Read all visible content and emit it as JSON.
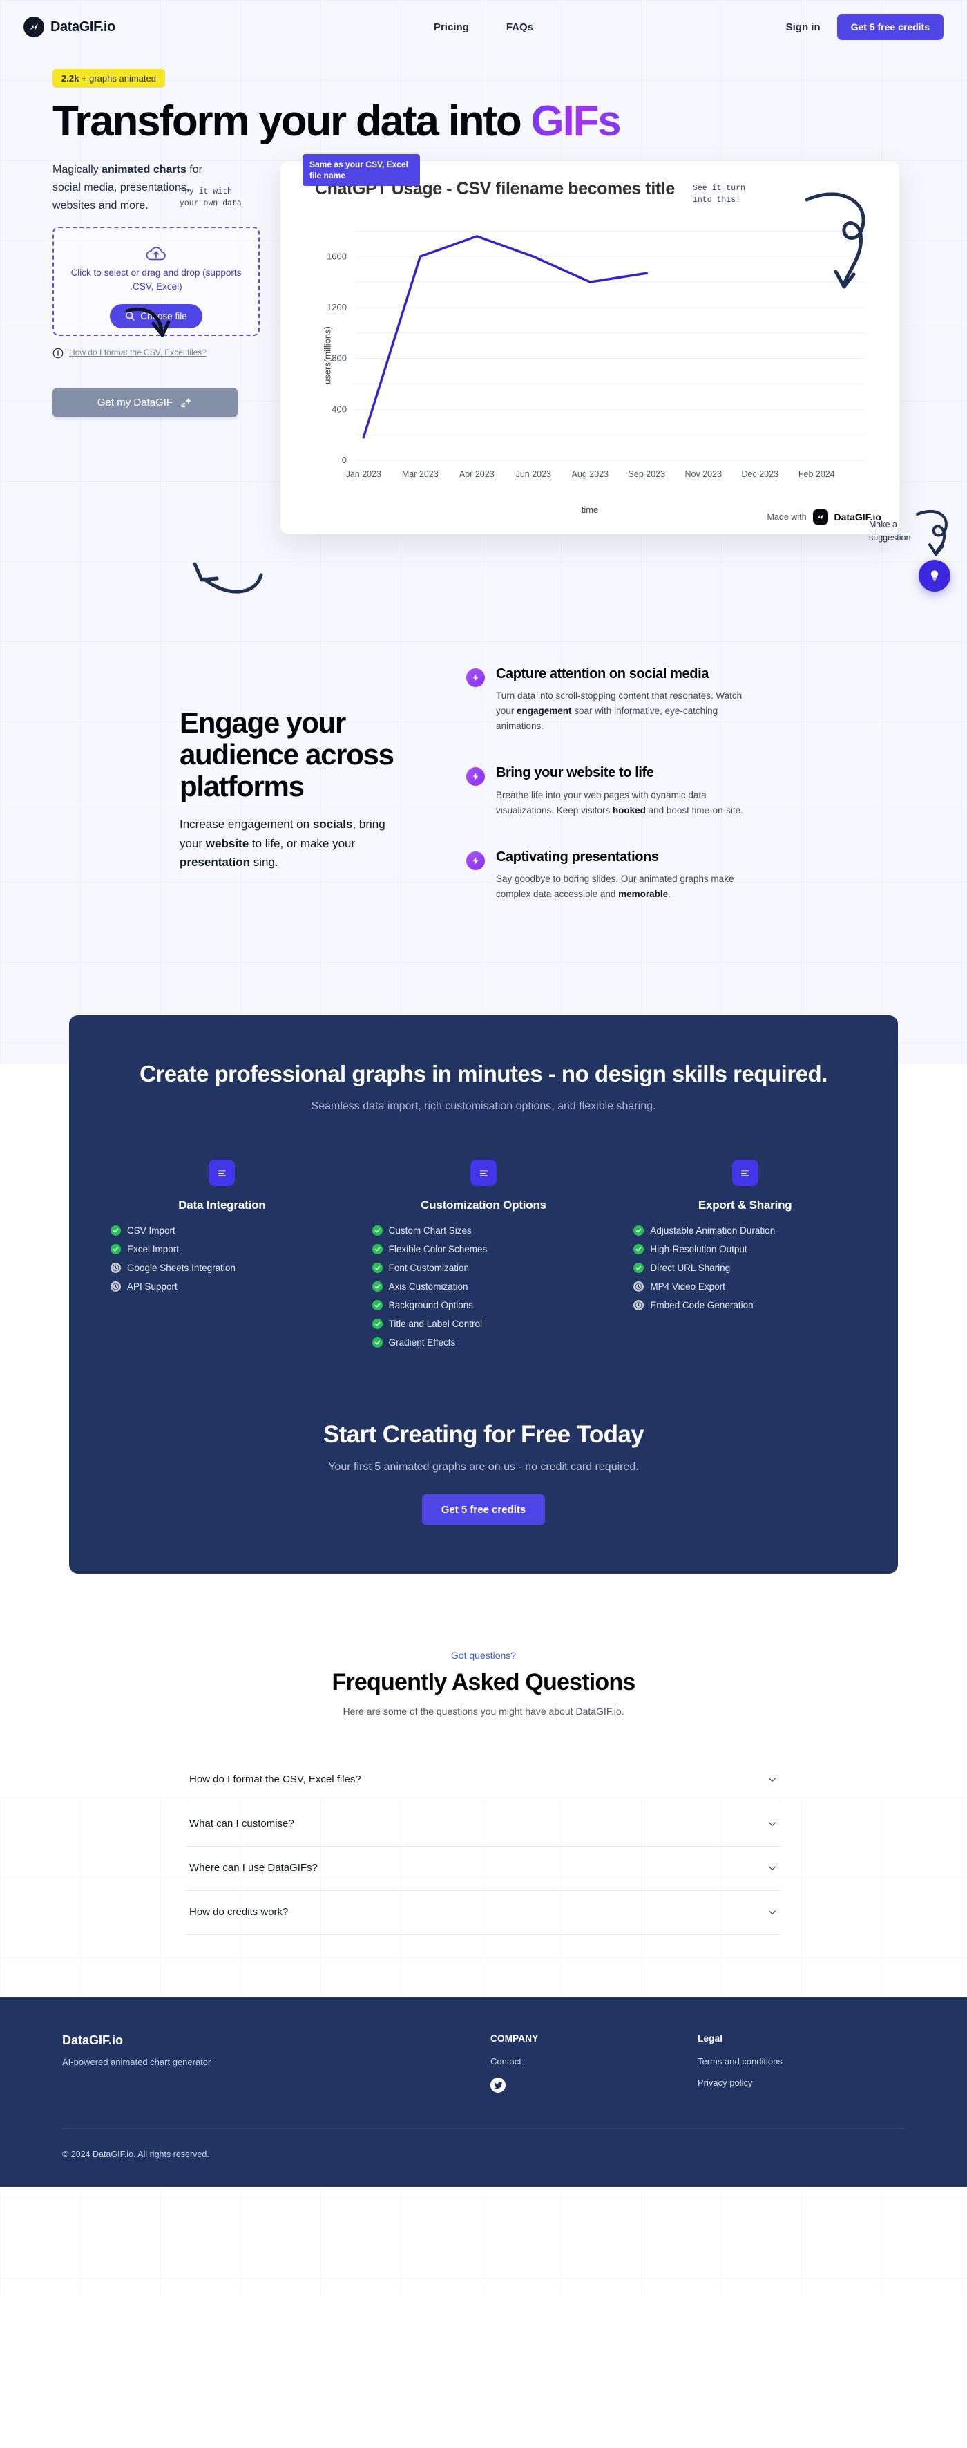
{
  "header": {
    "brand": "DataGIF.io",
    "links": [
      {
        "label": "Pricing"
      },
      {
        "label": "FAQs"
      }
    ],
    "signin": "Sign in",
    "cta": "Get 5 free credits"
  },
  "hero": {
    "badge_count": "2.2k",
    "badge_text": " + graphs animated",
    "title_line1": "Transform your data into ",
    "title_gifs": "GIFs",
    "lede_1": "Magically ",
    "lede_b1": "animated charts",
    "lede_2": " for social media, presentations, websites and more.",
    "annotation_try": "Try it with\nyour own data",
    "annotation_see": "See it turn\ninto this!",
    "annotation_suggestion": "Make a suggestion",
    "dropzone_text": "Click to select or drag and drop (supports .CSV, Excel)",
    "choose_file": "Choose file",
    "format_link": "How do I format the CSV, Excel files?",
    "get_gif": "Get my DataGIF"
  },
  "chart_card": {
    "tip": "Same as your CSV, Excel file name",
    "made_with_prefix": "Made with",
    "made_with_brand": "DataGIF.io"
  },
  "chart_data": {
    "type": "line",
    "title": "ChatGPT Usage - CSV filename becomes title",
    "xlabel": "time",
    "ylabel": "users(millions)",
    "categories": [
      "Jan 2023",
      "Mar 2023",
      "Apr 2023",
      "Jun 2023",
      "Aug 2023",
      "Sep 2023",
      "Nov 2023",
      "Dec 2023",
      "Feb 2024"
    ],
    "values": [
      180,
      1600,
      1760,
      1600,
      1400,
      1470,
      null,
      null,
      null
    ],
    "yticks": [
      0,
      400,
      800,
      1200,
      1600
    ],
    "ylim": [
      0,
      1900
    ],
    "grid": true,
    "legend": "none",
    "line_color": "#3a1fd1"
  },
  "engage": {
    "title": "Engage your audience across platforms",
    "sub_1": "Increase engagement on ",
    "sub_b1": "socials",
    "sub_2": ", bring your ",
    "sub_b2": "website",
    "sub_3": " to life, or make your ",
    "sub_b3": "presentation",
    "sub_4": " sing.",
    "features": [
      {
        "title": "Capture attention on social media",
        "body_1": "Turn data into scroll-stopping content that resonates. Watch your ",
        "body_b": "engagement",
        "body_2": " soar with informative, eye-catching animations."
      },
      {
        "title": "Bring your website to life",
        "body_1": "Breathe life into your web pages with dynamic data visualizations. Keep visitors ",
        "body_b": "hooked",
        "body_2": " and boost time-on-site."
      },
      {
        "title": "Captivating presentations",
        "body_1": "Say goodbye to boring slides. Our animated graphs make complex data accessible and ",
        "body_b": "memorable",
        "body_2": "."
      }
    ]
  },
  "panel": {
    "title": "Create professional graphs in minutes - no design skills required.",
    "subtitle": "Seamless data import, rich customisation options, and flexible sharing.",
    "columns": [
      {
        "heading": "Data Integration",
        "items": [
          {
            "label": "CSV Import",
            "status": "done"
          },
          {
            "label": "Excel Import",
            "status": "done"
          },
          {
            "label": "Google Sheets Integration",
            "status": "soon"
          },
          {
            "label": "API Support",
            "status": "soon"
          }
        ]
      },
      {
        "heading": "Customization Options",
        "items": [
          {
            "label": "Custom Chart Sizes",
            "status": "done"
          },
          {
            "label": "Flexible Color Schemes",
            "status": "done"
          },
          {
            "label": "Font Customization",
            "status": "done"
          },
          {
            "label": "Axis Customization",
            "status": "done"
          },
          {
            "label": "Background Options",
            "status": "done"
          },
          {
            "label": "Title and Label Control",
            "status": "done"
          },
          {
            "label": "Gradient Effects",
            "status": "done"
          }
        ]
      },
      {
        "heading": "Export & Sharing",
        "items": [
          {
            "label": "Adjustable Animation Duration",
            "status": "done"
          },
          {
            "label": "High-Resolution Output",
            "status": "done"
          },
          {
            "label": "Direct URL Sharing",
            "status": "done"
          },
          {
            "label": "MP4 Video Export",
            "status": "soon"
          },
          {
            "label": "Embed Code Generation",
            "status": "soon"
          }
        ]
      }
    ],
    "cta_title": "Start Creating for Free Today",
    "cta_sub": "Your first 5 animated graphs are on us - no credit card required.",
    "cta_button": "Get 5 free credits"
  },
  "faq": {
    "kicker": "Got questions?",
    "heading": "Frequently Asked Questions",
    "sub": "Here are some of the questions you might have about DataGIF.io.",
    "items": [
      {
        "q": "How do I format the CSV, Excel files?"
      },
      {
        "q": "What can I customise?"
      },
      {
        "q": "Where can I use DataGIFs?"
      },
      {
        "q": "How do credits work?"
      }
    ]
  },
  "footer": {
    "brand": "DataGIF.io",
    "tagline": "AI-powered animated chart generator",
    "company_heading": "COMPANY",
    "company_links": [
      {
        "label": "Contact"
      }
    ],
    "legal_heading": "Legal",
    "legal_links": [
      {
        "label": "Terms and conditions"
      },
      {
        "label": "Privacy policy"
      }
    ],
    "copyright": "© 2024 DataGIF.io. All rights reserved."
  },
  "colors": {
    "accent": "#4f46e5",
    "navy": "#223462",
    "purple": "#8b2ff0",
    "green": "#27c054",
    "yellow": "#f5e623",
    "chart_line": "#3a1fd1"
  }
}
